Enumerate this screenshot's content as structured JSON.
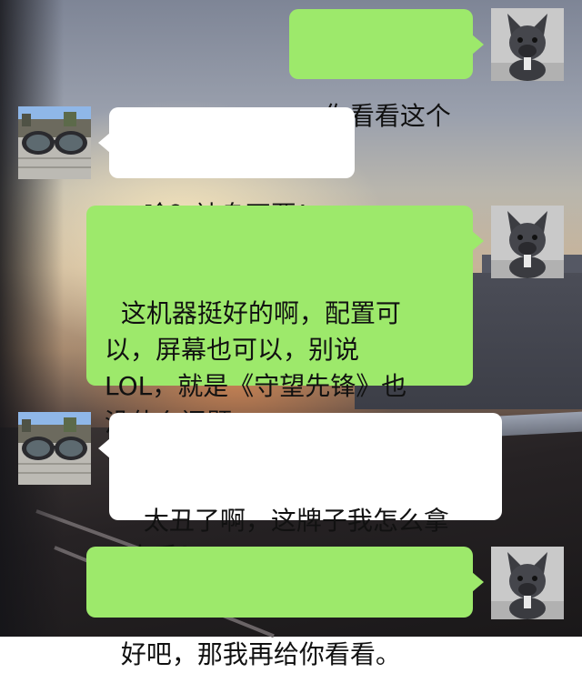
{
  "chat": {
    "messages": [
      {
        "sender": "me",
        "avatar": "dog-avatar-icon",
        "text": "你看看这个"
      },
      {
        "sender": "friend",
        "avatar": "sunglasses-avatar-icon",
        "text": "啥？神舟不要！"
      },
      {
        "sender": "me",
        "avatar": "dog-avatar-icon",
        "text": "这机器挺好的啊，配置可\n以，屏幕也可以，别说\nLOL，就是《守望先锋》也\n没什么问题。"
      },
      {
        "sender": "friend",
        "avatar": "sunglasses-avatar-icon",
        "text": "太丑了啊，这牌子我怎么拿\n出手？"
      },
      {
        "sender": "me",
        "avatar": "dog-avatar-icon",
        "text": "好吧，那我再给你看看。"
      }
    ]
  },
  "colors": {
    "sent_bubble": "#9de96b",
    "received_bubble": "#ffffff",
    "text": "#111111"
  }
}
